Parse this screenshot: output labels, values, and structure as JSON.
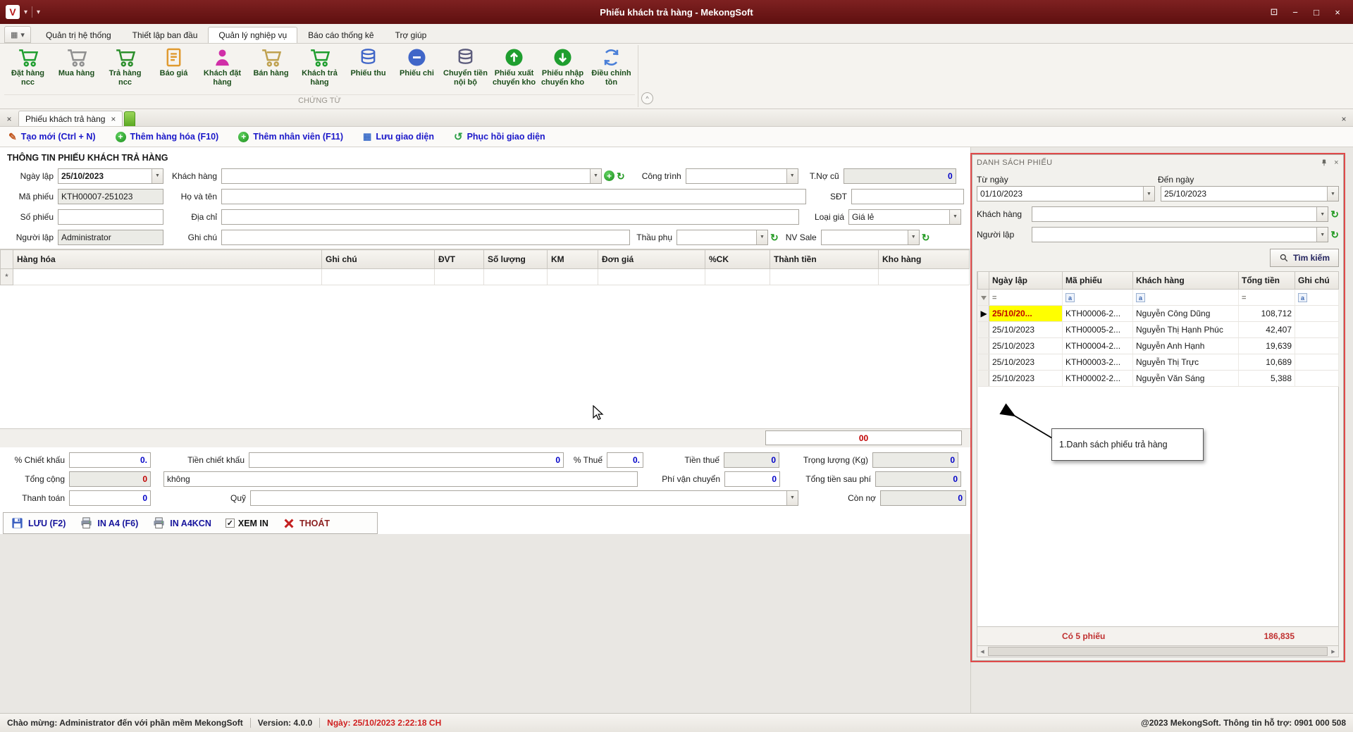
{
  "icons": {
    "dropdown": "▼",
    "refresh": "↻",
    "plus": "+",
    "close": "×",
    "minimize": "−",
    "restore": "□",
    "expand": "⊡",
    "caret": "▾",
    "grid": "▦",
    "new_row": "*",
    "current_row": "▶",
    "check": "✓",
    "collapse": "^",
    "filter_eq": "=",
    "filter_abc": "a",
    "left": "◀",
    "right": "▶",
    "pencil": "✎",
    "layout": "▦",
    "undo": "↺"
  },
  "colors": {
    "titlebar_maroon": "#6e1515",
    "link_blue": "#1a17c9",
    "value_blue": "#0202c8",
    "alert_red": "#c00000",
    "selected_yellow": "#ffff00",
    "annotation_red": "#e04a4a"
  },
  "titlebar": {
    "logo": "V",
    "title": "Phiếu khách trả hàng - MekongSoft"
  },
  "menubar": {
    "tabs": [
      {
        "label": "Quản trị hệ thống"
      },
      {
        "label": "Thiết lập ban đầu"
      },
      {
        "label": "Quản lý nghiệp vụ"
      },
      {
        "label": "Báo cáo thống kê"
      },
      {
        "label": "Trợ giúp"
      }
    ]
  },
  "ribbon": {
    "group_label": "CHỨNG TỪ",
    "items": [
      {
        "label": "Đặt hàng ncc"
      },
      {
        "label": "Mua hàng"
      },
      {
        "label": "Trả hàng ncc"
      },
      {
        "label": "Báo giá"
      },
      {
        "label": "Khách đặt hàng"
      },
      {
        "label": "Bán hàng"
      },
      {
        "label": "Khách trả hàng"
      },
      {
        "label": "Phiếu thu"
      },
      {
        "label": "Phiếu chi"
      },
      {
        "label": "Chuyển tiền nội bộ"
      },
      {
        "label": "Phiếu xuất chuyển kho"
      },
      {
        "label": "Phiếu nhập chuyển kho"
      },
      {
        "label": "Điều chỉnh tồn"
      }
    ]
  },
  "doctab": {
    "label": "Phiếu khách trả hàng"
  },
  "linkbar": {
    "items": [
      {
        "label": "Tạo mới (Ctrl + N)"
      },
      {
        "label": "Thêm hàng hóa (F10)"
      },
      {
        "label": "Thêm nhân viên (F11)"
      },
      {
        "label": "Lưu giao diện"
      },
      {
        "label": "Phục hồi giao diện"
      }
    ]
  },
  "form": {
    "section_title": "THÔNG TIN PHIẾU KHÁCH TRẢ HÀNG",
    "ngay_lap": {
      "label": "Ngày lập",
      "value": "25/10/2023"
    },
    "khach_hang": {
      "label": "Khách hàng",
      "value": ""
    },
    "cong_trinh": {
      "label": "Công trình",
      "value": ""
    },
    "t_no_cu": {
      "label": "T.Nợ cũ",
      "value": "0"
    },
    "ma_phieu": {
      "label": "Mã phiếu",
      "value": "KTH00007-251023"
    },
    "ho_va_ten": {
      "label": "Họ và tên",
      "value": ""
    },
    "sdt": {
      "label": "SĐT",
      "value": ""
    },
    "so_phieu": {
      "label": "Số phiếu",
      "value": ""
    },
    "dia_chi": {
      "label": "Địa chỉ",
      "value": ""
    },
    "loai_gia": {
      "label": "Loại giá",
      "value": "Giá lẻ"
    },
    "nguoi_lap": {
      "label": "Người lập",
      "value": "Administrator"
    },
    "ghi_chu": {
      "label": "Ghi chú",
      "value": ""
    },
    "thau_phu": {
      "label": "Thầu phụ",
      "value": ""
    },
    "nv_sale": {
      "label": "NV Sale",
      "value": ""
    }
  },
  "items_grid": {
    "columns": [
      {
        "label": "Hàng hóa"
      },
      {
        "label": "Ghi chú"
      },
      {
        "label": "ĐVT"
      },
      {
        "label": "Số lượng"
      },
      {
        "label": "KM"
      },
      {
        "label": "Đơn giá"
      },
      {
        "label": "%CK"
      },
      {
        "label": "Thành tiền"
      },
      {
        "label": "Kho hàng"
      }
    ],
    "total_display": "00"
  },
  "totals": {
    "pct_ck": {
      "label": "% Chiết khấu",
      "value": "0."
    },
    "tien_ck": {
      "label": "Tiền chiết khấu",
      "value": "0"
    },
    "pct_thue": {
      "label": "% Thuế",
      "value": "0."
    },
    "tien_thue": {
      "label": "Tiền thuế",
      "value": "0"
    },
    "trong_luong": {
      "label": "Trọng lượng (Kg)",
      "value": "0"
    },
    "tong_cong": {
      "label": "Tổng cộng",
      "value": "0"
    },
    "tong_cong_text": "không",
    "phi_vc": {
      "label": "Phí vận chuyển",
      "value": "0"
    },
    "tong_sau_phi": {
      "label": "Tổng tiền sau phí",
      "value": "0"
    },
    "thanh_toan": {
      "label": "Thanh toán",
      "value": "0"
    },
    "quy": {
      "label": "Quỹ",
      "value": ""
    },
    "con_no": {
      "label": "Còn nợ",
      "value": "0"
    }
  },
  "actions": {
    "luu": "LƯU (F2)",
    "in_a4": "IN A4 (F6)",
    "in_a4kcn": "IN A4KCN",
    "xem_in": "XEM IN",
    "thoat": "THOÁT"
  },
  "panel": {
    "title": "DANH SÁCH PHIẾU",
    "tu_ngay": {
      "label": "Từ ngày",
      "value": "01/10/2023"
    },
    "den_ngay": {
      "label": "Đến ngày",
      "value": "25/10/2023"
    },
    "khach_hang": {
      "label": "Khách hàng",
      "value": ""
    },
    "nguoi_lap": {
      "label": "Người lập",
      "value": ""
    },
    "search_label": "Tìm kiếm",
    "grid": {
      "columns": [
        {
          "label": "Ngày lập"
        },
        {
          "label": "Mã phiếu"
        },
        {
          "label": "Khách hàng"
        },
        {
          "label": "Tổng tiền"
        },
        {
          "label": "Ghi chú"
        }
      ],
      "rows": [
        {
          "ngay": "25/10/20...",
          "ma": "KTH00006-2...",
          "kh": "Nguyễn Công Dũng",
          "tien": "108,712",
          "ghichu": ""
        },
        {
          "ngay": "25/10/2023",
          "ma": "KTH00005-2...",
          "kh": "Nguyễn Thị Hạnh Phúc",
          "tien": "42,407",
          "ghichu": ""
        },
        {
          "ngay": "25/10/2023",
          "ma": "KTH00004-2...",
          "kh": "Nguyễn Anh Hạnh",
          "tien": "19,639",
          "ghichu": ""
        },
        {
          "ngay": "25/10/2023",
          "ma": "KTH00003-2...",
          "kh": "Nguyễn Thị Trực",
          "tien": "10,689",
          "ghichu": ""
        },
        {
          "ngay": "25/10/2023",
          "ma": "KTH00002-2...",
          "kh": "Nguyễn Văn Sáng",
          "tien": "5,388",
          "ghichu": ""
        }
      ],
      "footer_count": "Có 5 phiếu",
      "footer_total": "186,835"
    },
    "callout": "1.Danh sách phiếu trả hàng"
  },
  "statusbar": {
    "welcome": "Chào mừng: Administrator đến với phần mềm MekongSoft",
    "version": "Version: 4.0.0",
    "date": "Ngày: 25/10/2023 2:22:18 CH",
    "support": "@2023 MekongSoft. Thông tin hỗ trợ: 0901 000 508"
  }
}
